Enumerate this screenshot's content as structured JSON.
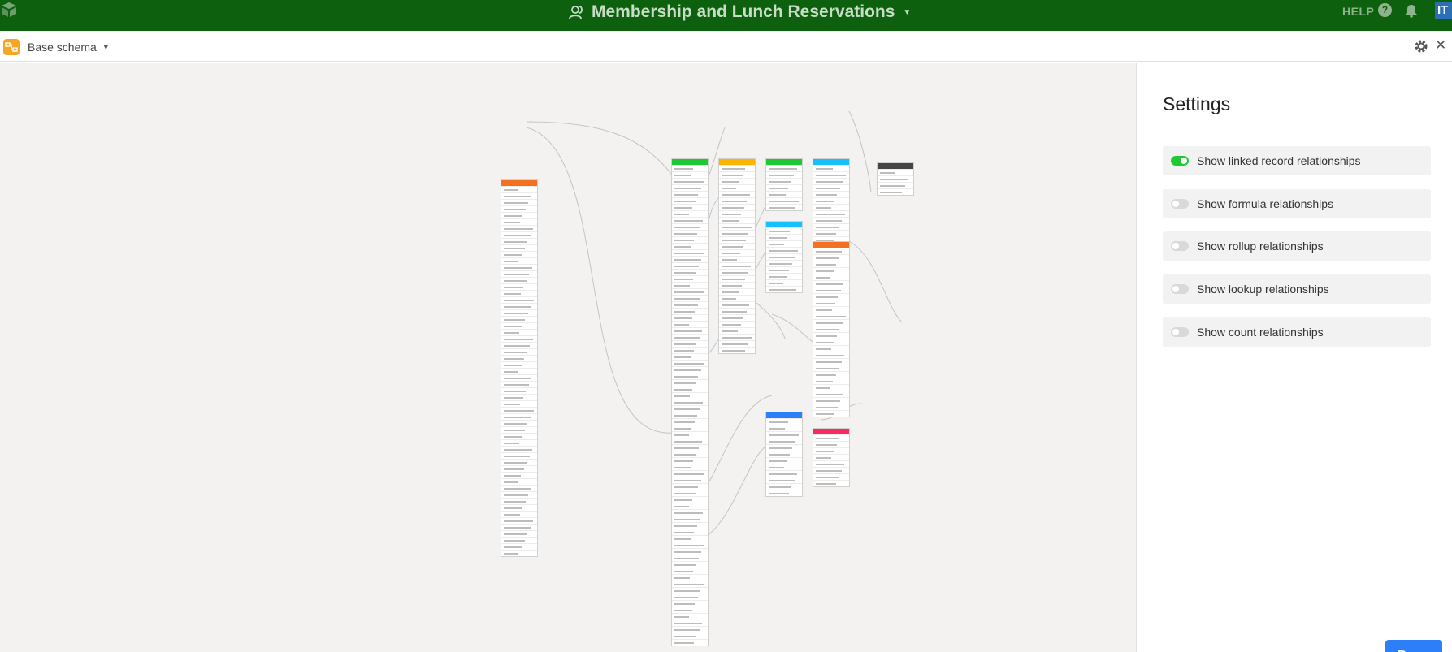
{
  "app": {
    "base_title": "Membership and Lunch Reservations",
    "help_label": "HELP",
    "help_icon": "?",
    "avatar_initials": "IT",
    "brand_color": "#0d600d"
  },
  "modal": {
    "title": "Base schema",
    "close_glyph": "✕"
  },
  "settings": {
    "heading": "Settings",
    "options": [
      {
        "label": "Show linked record relationships",
        "on": true
      },
      {
        "label": "Show formula relationships",
        "on": false
      },
      {
        "label": "Show rollup relationships",
        "on": false
      },
      {
        "label": "Show lookup relationships",
        "on": false
      },
      {
        "label": "Show count relationships",
        "on": false
      }
    ],
    "done_label": "Done",
    "accent": "#2d7ff9",
    "toggle_on_color": "#20c933"
  },
  "schema": {
    "tables": [
      {
        "color": "#f37221",
        "fields": 57
      },
      {
        "color": "#20c933",
        "fields": 74
      },
      {
        "color": "#fcb400",
        "fields": 29
      },
      {
        "color": "#20c933",
        "fields": 7
      },
      {
        "color": "#18bfff",
        "fields": 21
      },
      {
        "color": "#18bfff",
        "fields": 10
      },
      {
        "color": "#f37221",
        "fields": 26
      },
      {
        "color": "#444444",
        "fields": 4
      },
      {
        "color": "#2d7ff9",
        "fields": 12
      },
      {
        "color": "#f82b60",
        "fields": 8
      }
    ]
  }
}
